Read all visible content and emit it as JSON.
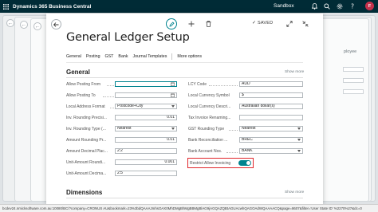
{
  "topbar": {
    "app_title": "Dynamics 365 Business Central",
    "environment": "Sandbox",
    "avatar_initial": "F"
  },
  "background": {
    "right_text": "ployee"
  },
  "toolbar": {
    "saved_label": "SAVED"
  },
  "page": {
    "title": "General Ledger Setup",
    "menu": [
      "General",
      "Posting",
      "GST",
      "Bank",
      "Journal Templates"
    ],
    "more_options": "More options"
  },
  "general": {
    "title": "General",
    "show_more": "Show more",
    "left_fields": [
      {
        "label": "Allow Posting From",
        "value": "",
        "type": "date"
      },
      {
        "label": "Allow Posting To",
        "value": "",
        "type": "date"
      },
      {
        "label": "Local Address Format",
        "value": "Postcode+City",
        "type": "select"
      },
      {
        "label": "Inv. Rounding Precisi...",
        "value": "0.01",
        "type": "number"
      },
      {
        "label": "Inv. Rounding Type (...",
        "value": "Nearest",
        "type": "select"
      },
      {
        "label": "Amount Rounding Pr...",
        "value": "0.01",
        "type": "number"
      },
      {
        "label": "Amount Decimal Plac...",
        "value": "2:2",
        "type": "text"
      },
      {
        "label": "Unit-Amount Roundi...",
        "value": "0.001",
        "type": "number"
      },
      {
        "label": "Unit-Amount Decima...",
        "value": "2:5",
        "type": "text"
      }
    ],
    "right_fields": [
      {
        "label": "LCY Code",
        "value": "AUD",
        "type": "text"
      },
      {
        "label": "Local Currency Symbol",
        "value": "$",
        "type": "text"
      },
      {
        "label": "Local Currency Descri...",
        "value": "Australian dollar(s)",
        "type": "text"
      },
      {
        "label": "Tax Invoice Renaming...",
        "value": "",
        "type": "text"
      },
      {
        "label": "GST Rounding Type",
        "value": "Nearest",
        "type": "select"
      },
      {
        "label": "Bank Reconciliation ...",
        "value": "BREC",
        "type": "select"
      },
      {
        "label": "Bank Account Nos.",
        "value": "BANK",
        "type": "select"
      }
    ],
    "restrict_label": "Restrict Allow Invoicing",
    "restrict_on": true
  },
  "dimensions": {
    "title": "Dimensions",
    "show_more": "Show more"
  },
  "status": {
    "url": "bcdev24.nmicksoftware.com.au:10080/BC/?company=CRONUS AU&bookmark=23%3bdQAAAJmhsOAX0MhDMgBhMgBBMgBlAG9jAGQAZQBtAGUAcwhQAGOAdWQAAAACQ&page=8607&filter='User State ID' %2270%27&dc=0"
  },
  "colors": {
    "topbar": "#002b36",
    "accent": "#00838f",
    "highlight": "#e0262b"
  }
}
